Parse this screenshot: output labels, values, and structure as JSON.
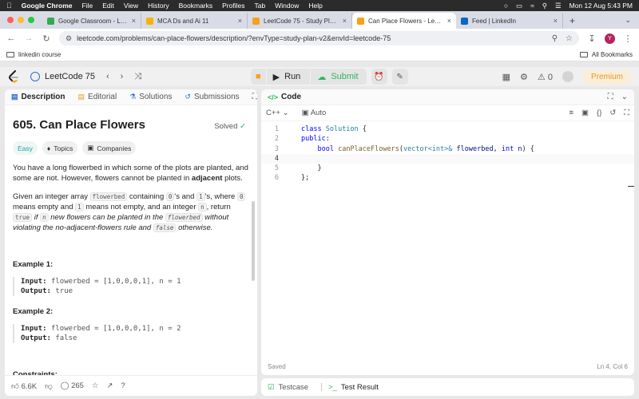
{
  "menubar": {
    "app": "Google Chrome",
    "items": [
      "File",
      "Edit",
      "View",
      "History",
      "Bookmarks",
      "Profiles",
      "Tab",
      "Window",
      "Help"
    ],
    "clock": "Mon 12 Aug  5:43 PM"
  },
  "tabs": [
    {
      "title": "Google Classroom - Login",
      "color": "#34a853"
    },
    {
      "title": "MCA Ds and Ai 11",
      "color": "#f4b400"
    },
    {
      "title": "LeetCode 75 - Study Plan - L",
      "color": "#f89f1b"
    },
    {
      "title": "Can Place Flowers - LeetCode",
      "color": "#f89f1b"
    },
    {
      "title": "Feed | LinkedIn",
      "color": "#0a66c2"
    }
  ],
  "address": {
    "url": "leetcode.com/problems/can-place-flowers/description/?envType=study-plan-v2&envId=leetcode-75"
  },
  "bookmarks": {
    "item": "linkedin course",
    "all": "All Bookmarks"
  },
  "profile": {
    "initial": "Y"
  },
  "lcnav": {
    "study_plan": "LeetCode 75",
    "run": "Run",
    "submit": "Submit",
    "fire_count": "0",
    "premium": "Premium"
  },
  "left_tabs": {
    "description": "Description",
    "editorial": "Editorial",
    "solutions": "Solutions",
    "submissions": "Submissions"
  },
  "problem": {
    "title": "605. Can Place Flowers",
    "status": "Solved",
    "difficulty": "Easy",
    "topics": "Topics",
    "companies": "Companies",
    "p1_a": "You have a long flowerbed in which some of the plots are planted, and some are not. However, flowers cannot be planted in ",
    "p1_b": "adjacent",
    "p1_c": " plots.",
    "p2": {
      "t1": "Given an integer array ",
      "c1": "flowerbed",
      "t2": " containing ",
      "c2": "0",
      "t3": "'s and ",
      "c3": "1",
      "t4": "'s, where ",
      "c4": "0",
      "t5": " means empty and ",
      "c5": "1",
      "t6": " means not empty, and an integer ",
      "c6": "n",
      "t7": ", return ",
      "c7": "true",
      "t8": " if ",
      "c8": "n",
      "t9": " new flowers can be planted in the ",
      "c9": "flowerbed",
      "t10": " without violating the no-adjacent-flowers rule and ",
      "c10": "false",
      "t11": " otherwise."
    },
    "examples": [
      {
        "heading": "Example 1:",
        "input_label": "Input:",
        "input": "flowerbed = [1,0,0,0,1], n = 1",
        "output_label": "Output:",
        "output": "true"
      },
      {
        "heading": "Example 2:",
        "input_label": "Input:",
        "input": "flowerbed = [1,0,0,0,1], n = 2",
        "output_label": "Output:",
        "output": "false"
      }
    ],
    "constraints_heading": "Constraints:"
  },
  "footer": {
    "likes": "6.6K",
    "comments": "265"
  },
  "code_panel": {
    "title": "Code",
    "language": "C++",
    "mode": "Auto",
    "saved": "Saved",
    "cursor": "Ln 4, Col 6"
  },
  "code_lines": [
    "1",
    "2",
    "3",
    "4",
    "5",
    "6"
  ],
  "code": {
    "l1_kw": "class",
    "l1_name": "Solution",
    "l1_rest": " {",
    "l2": "public:",
    "l3_ret": "bool",
    "l3_fn": "canPlaceFlowers",
    "l3_type": "vector<int>&",
    "l3_p1": "flowerbed",
    "l3_int": "int",
    "l3_p2": "n",
    "l5": "}",
    "l6": "};"
  },
  "bottom_tabs": {
    "testcase": "Testcase",
    "result": "Test Result"
  }
}
